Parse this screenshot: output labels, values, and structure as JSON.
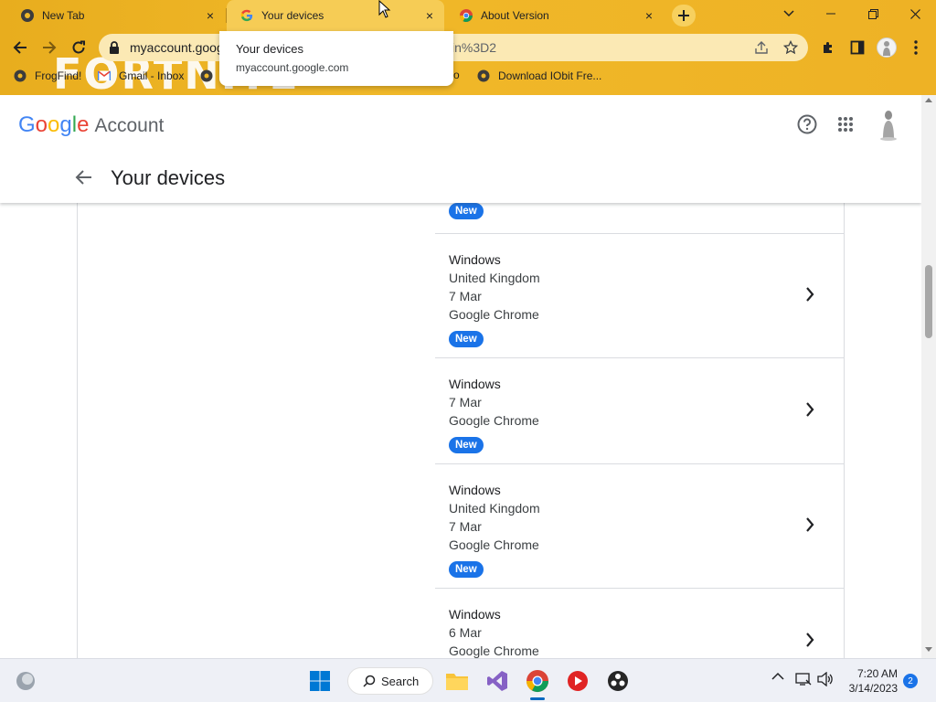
{
  "browser": {
    "tabs": [
      {
        "title": "New Tab",
        "close": "×"
      },
      {
        "title": "Your devices",
        "close": "×"
      },
      {
        "title": "About Version",
        "close": "×"
      }
    ],
    "new_tab": "+",
    "url_visible_start": "myaccount.goog",
    "url_visible_end": "in%3D2",
    "tooltip": {
      "title": "Your devices",
      "domain": "myaccount.google.com"
    },
    "bookmarks": [
      {
        "label": "FrogFind!"
      },
      {
        "label": "Gmail - Inbox"
      },
      {
        "label": "Download IObit Fre..."
      }
    ],
    "bookmark_fragment": "o",
    "background_theme_text": "FORTNITE",
    "theme_color": "#f0b829"
  },
  "header": {
    "logo_letters": [
      "G",
      "o",
      "o",
      "g",
      "l",
      "e"
    ],
    "logo_colors": [
      "#4285f4",
      "#ea4335",
      "#fbbc05",
      "#4285f4",
      "#34a853",
      "#ea4335"
    ],
    "logo_suffix": "Account",
    "page_title": "Your devices"
  },
  "devices": {
    "badge_label": "New",
    "rows": [
      {
        "os": "Windows",
        "lines": [
          "United Kingdom",
          "7 Mar",
          "Google Chrome"
        ],
        "new": true
      },
      {
        "os": "Windows",
        "lines": [
          "7 Mar",
          "Google Chrome"
        ],
        "new": true
      },
      {
        "os": "Windows",
        "lines": [
          "United Kingdom",
          "7 Mar",
          "Google Chrome"
        ],
        "new": true
      },
      {
        "os": "Windows",
        "lines": [
          "6 Mar",
          "Google Chrome"
        ],
        "new": false
      }
    ]
  },
  "taskbar": {
    "search_label": "Search",
    "time": "7:20 AM",
    "date": "3/14/2023",
    "notification_count": "2"
  }
}
